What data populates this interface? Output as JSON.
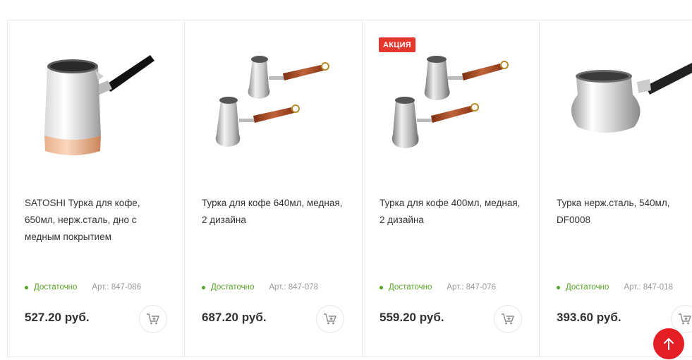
{
  "products": [
    {
      "title": "SATOSHI Турка для кофе, 650мл, нерж.сталь, дно с медным покрытием",
      "stock": "Достаточно",
      "article": "Арт.: 847-086",
      "price": "527.20 руб."
    },
    {
      "title": "Турка для кофе 640мл, медная, 2 дизайна",
      "stock": "Достаточно",
      "article": "Арт.: 847-078",
      "price": "687.20 руб."
    },
    {
      "title": "Турка для кофе 400мл, медная, 2 дизайна",
      "badge": "АКЦИЯ",
      "stock": "Достаточно",
      "article": "Арт.: 847-076",
      "price": "559.20 руб."
    },
    {
      "title": "Турка нерж.сталь, 540мл, DF0008",
      "stock": "Достаточно",
      "article": "Арт.: 847-018",
      "price": "393.60 руб."
    }
  ],
  "icons": {
    "cart": "cart-plus-icon",
    "scroll_top": "arrow-up-icon"
  },
  "colors": {
    "stock_green": "#58a323",
    "badge_red": "#e5362d",
    "scroll_top_red": "#e41e25"
  }
}
